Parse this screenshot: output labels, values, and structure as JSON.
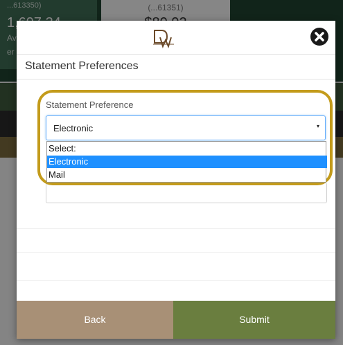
{
  "background": {
    "card_left": {
      "account": "...613350)",
      "amount": "1,697.34",
      "label1": "Av...",
      "label2": "er"
    },
    "card_mid": {
      "account": "(...61351)",
      "amount": "$80.92"
    }
  },
  "modal": {
    "logo_text": "DW",
    "title": "Statement Preferences",
    "field_label": "Statement Preference",
    "select_value": "Electronic",
    "caret": "▾",
    "options": [
      {
        "label": "Select:",
        "selected": false
      },
      {
        "label": "Electronic",
        "selected": true
      },
      {
        "label": "Mail",
        "selected": false
      }
    ],
    "back_label": "Back",
    "submit_label": "Submit"
  },
  "colors": {
    "highlight_ring": "#c39b1b",
    "back_button": "#a89076",
    "submit_button": "#6a7e3f",
    "selected_option": "#1e90ff"
  },
  "icons": {
    "close": "close-circle-icon",
    "logo": "dw-logo-icon"
  }
}
